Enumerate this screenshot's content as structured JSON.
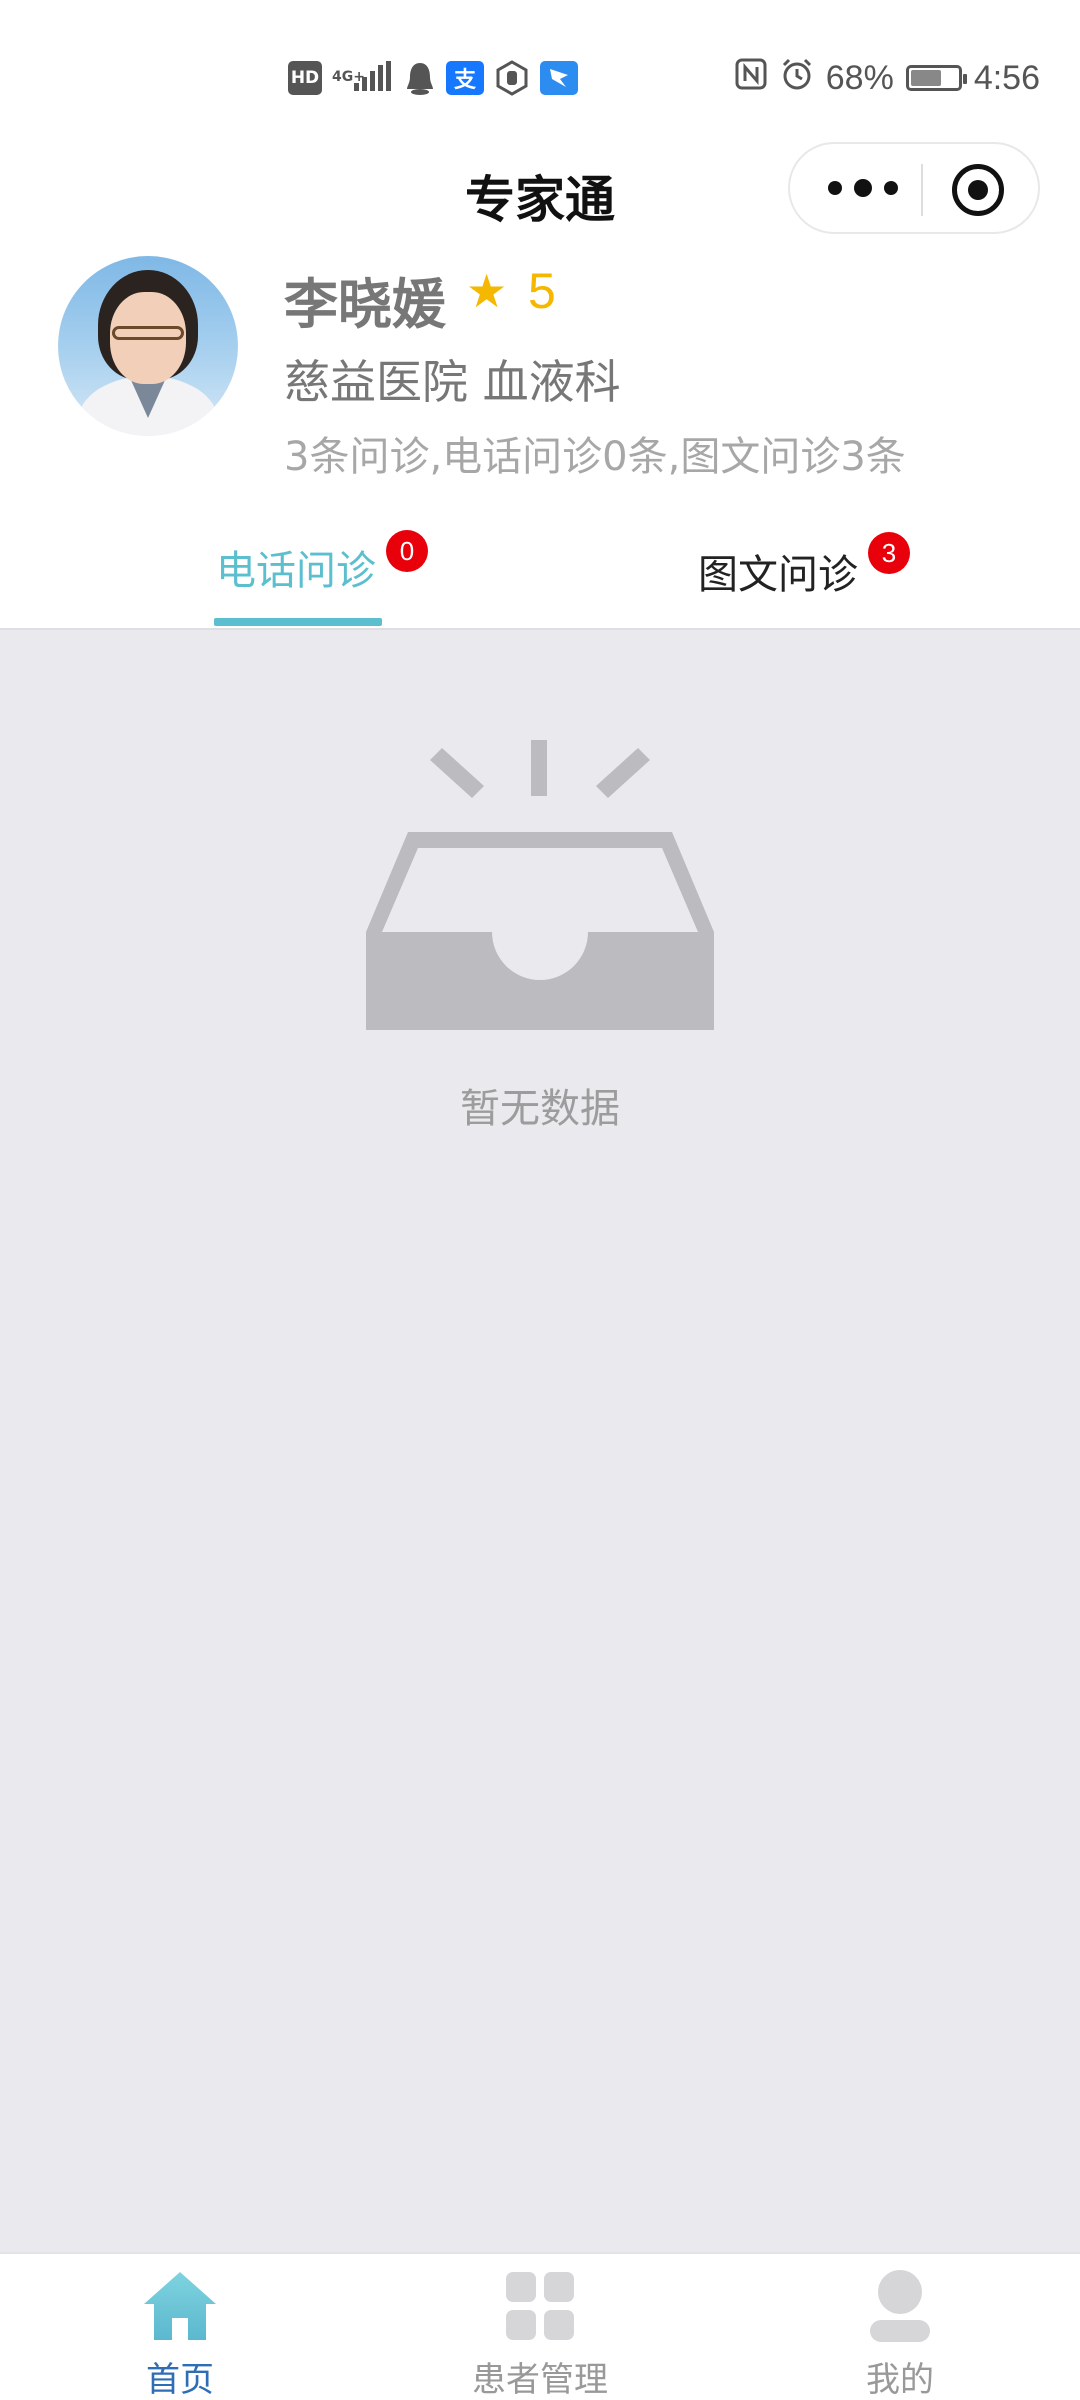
{
  "statusbar": {
    "battery_text": "68%",
    "time": "4:56",
    "hd_label": "HD",
    "network_label": "4G+",
    "alipay_label": "支"
  },
  "header": {
    "title": "专家通"
  },
  "doctor": {
    "name": "李晓媛",
    "rating": "5",
    "hospital": "慈益医院 血液科",
    "stats": "3条问诊,电话问诊0条,图文问诊3条"
  },
  "tabs": [
    {
      "label": "电话问诊",
      "badge": "0",
      "active": true
    },
    {
      "label": "图文问诊",
      "badge": "3",
      "active": false
    }
  ],
  "empty": {
    "text": "暂无数据"
  },
  "bottom_nav": [
    {
      "label": "首页",
      "icon": "home-icon",
      "active": true
    },
    {
      "label": "患者管理",
      "icon": "grid-icon",
      "active": false
    },
    {
      "label": "我的",
      "icon": "user-icon",
      "active": false
    }
  ],
  "colors": {
    "accent": "#5bbfcf",
    "rating": "#f5b800",
    "badge": "#e8000b",
    "nav_active": "#2f6eb5",
    "content_bg": "#e9e9ee"
  }
}
